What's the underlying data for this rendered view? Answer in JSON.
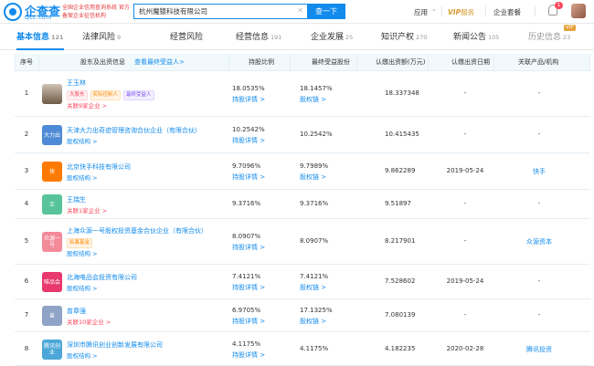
{
  "header": {
    "logo_text": "企查查",
    "logo_sub": "Qcc.com",
    "slogan": "全国企业信用查询系统 官方备案企业征信机构",
    "search": {
      "value": "杭州魔猿科技有限公司",
      "clear": "✕",
      "button": "查一下"
    },
    "nav": {
      "app": "应用",
      "app_caret": "⌄",
      "vip": "VIP",
      "vip_sub": "服务",
      "biz": "企业套餐",
      "badge": "1"
    }
  },
  "tabs": [
    {
      "label": "基本信息",
      "count": "121"
    },
    {
      "label": "法律风险",
      "count": "9"
    },
    {
      "label": "经营风险",
      "count": ""
    },
    {
      "label": "经营信息",
      "count": "191"
    },
    {
      "label": "企业发展",
      "count": "25"
    },
    {
      "label": "知识产权",
      "count": "270"
    },
    {
      "label": "新闻公告",
      "count": "105"
    },
    {
      "label": "历史信息",
      "count": "23"
    }
  ],
  "vip_tag": "VIP",
  "table": {
    "headers": {
      "seq": "序号",
      "holder": "股东及出资信息",
      "beneficiary_link": "查看最终受益人>",
      "ratio": "持股比例",
      "final_ratio": "最终受益股份",
      "amount": "认缴出资额(万元)",
      "date": "认缴出资日期",
      "related": "关联产品/机构"
    },
    "rows": [
      {
        "seq": "1",
        "logo": "",
        "logo_color": "#7a6a5a",
        "name": "王玉林",
        "tags": [
          {
            "text": "大股东",
            "style": "red"
          },
          {
            "text": "实际控制人",
            "style": "orange"
          },
          {
            "text": "最终受益人",
            "style": "purple"
          }
        ],
        "sub": "关联9家企业 >",
        "ratio": "18.0535%",
        "ratio_link": "持股详情 >",
        "final_ratio": "18.1457%",
        "final_link": "股权链 >",
        "amount": "18.337348",
        "date": "-",
        "related": "-"
      },
      {
        "seq": "2",
        "logo": "大力出",
        "logo_color": "#4e8ad6",
        "name": "天津大力出奇迹管理咨询合伙企业（有限合伙）",
        "tags": [],
        "sub": "股权结构 >",
        "ratio": "10.2542%",
        "ratio_link": "持股详情 >",
        "final_ratio": "10.2542%",
        "final_link": "",
        "amount": "10.415435",
        "date": "-",
        "related": "-"
      },
      {
        "seq": "3",
        "logo": "快",
        "logo_color": "#ff7a00",
        "name": "北京快手科技有限公司",
        "tags": [],
        "sub": "股权结构 >",
        "ratio": "9.7096%",
        "ratio_link": "持股详情 >",
        "final_ratio": "9.7989%",
        "final_link": "股权链 >",
        "amount": "9.862289",
        "date": "2019-05-24",
        "related": "快手"
      },
      {
        "seq": "4",
        "logo": "王",
        "logo_color": "#59c49b",
        "name": "王瑞生",
        "tags": [],
        "sub": "关联1家企业 >",
        "ratio": "9.3716%",
        "ratio_link": "",
        "final_ratio": "9.3716%",
        "final_link": "",
        "amount": "9.51897",
        "date": "-",
        "related": "-"
      },
      {
        "seq": "5",
        "logo": "众源一号",
        "logo_color": "#f28a9a",
        "name": "上海众源一号股权投资基金合伙企业（有限合伙）",
        "tags": [
          {
            "text": "私募基金",
            "style": "orange"
          }
        ],
        "sub": "股权结构 >",
        "ratio": "8.0907%",
        "ratio_link": "持股详情 >",
        "final_ratio": "8.0907%",
        "final_link": "",
        "amount": "8.217901",
        "date": "-",
        "related": "众源资本"
      },
      {
        "seq": "6",
        "logo": "唯品会",
        "logo_color": "#e8386d",
        "name": "北海唯品会投资有限公司",
        "tags": [],
        "sub": "股权结构 >",
        "ratio": "7.4121%",
        "ratio_link": "持股详情 >",
        "final_ratio": "7.4121%",
        "final_link": "股权链 >",
        "amount": "7.528602",
        "date": "2019-05-24",
        "related": "-"
      },
      {
        "seq": "7",
        "logo": "曾",
        "logo_color": "#8fa3c7",
        "name": "曾章强",
        "tags": [],
        "sub": "关联10家企业 >",
        "ratio": "6.9705%",
        "ratio_link": "持股详情 >",
        "final_ratio": "17.1325%",
        "final_link": "股权链 >",
        "amount": "7.080139",
        "date": "-",
        "related": "-"
      },
      {
        "seq": "8",
        "logo": "腾讯创业",
        "logo_color": "#4ca7d8",
        "name": "深圳市腾讯创业创新发展有限公司",
        "tags": [],
        "sub": "股权结构 >",
        "ratio": "4.1175%",
        "ratio_link": "持股详情 >",
        "final_ratio": "4.1175%",
        "final_link": "",
        "amount": "4.182235",
        "date": "2020-02-28",
        "related": "腾讯投资"
      }
    ]
  }
}
